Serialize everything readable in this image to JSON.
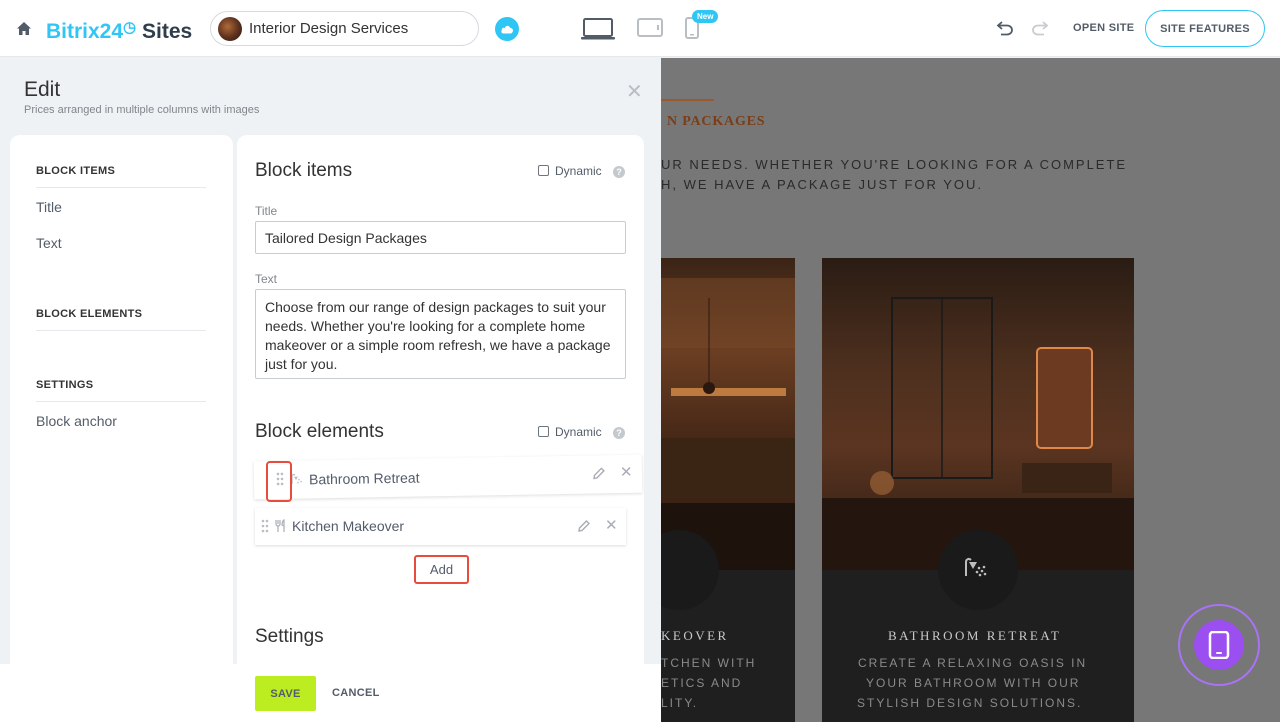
{
  "topbar": {
    "logo_brand": "Bitrix24",
    "logo_sites": "Sites",
    "site_name": "Interior Design Services",
    "new_badge": "New",
    "open_site": "OPEN SITE",
    "site_features": "SITE FEATURES",
    "icons": [
      "home-icon",
      "cloud-icon",
      "desktop-icon",
      "tablet-icon",
      "mobile-icon",
      "undo-icon",
      "redo-icon"
    ]
  },
  "edit": {
    "title": "Edit",
    "subtitle": "Prices arranged in multiple columns with images",
    "nav": {
      "block_items_head": "BLOCK ITEMS",
      "title_item": "Title",
      "text_item": "Text",
      "block_elements_head": "BLOCK ELEMENTS",
      "settings_head": "SETTINGS",
      "block_anchor_item": "Block anchor"
    },
    "form": {
      "block_items_title": "Block items",
      "dynamic_label": "Dynamic",
      "title_label": "Title",
      "title_value": "Tailored Design Packages",
      "text_label": "Text",
      "text_value": "Choose from our range of design packages to suit your needs. Whether you're looking for a complete home makeover or a simple room refresh, we have a package just for you.",
      "block_elements_title": "Block elements",
      "elements": [
        {
          "label": "Bathroom Retreat"
        },
        {
          "label": "Kitchen Makeover"
        }
      ],
      "add_label": "Add",
      "settings_title": "Settings"
    },
    "footer": {
      "save_label": "SAVE",
      "cancel_label": "CANCEL"
    }
  },
  "preview": {
    "heading": "N PACKAGES",
    "text_line1": "UR NEEDS. WHETHER YOU'RE LOOKING FOR A COMPLETE",
    "text_line2": "H, WE HAVE A PACKAGE JUST FOR YOU.",
    "card1_title": "KEOVER",
    "card1_desc1": "TCHEN WITH",
    "card1_desc2": "ETICS AND",
    "card1_desc3": "LITY.",
    "card2_title": "BATHROOM RETREAT",
    "card2_desc1": "CREATE A RELAXING OASIS IN",
    "card2_desc2": "YOUR BATHROOM WITH OUR",
    "card2_desc3": "STYLISH DESIGN SOLUTIONS."
  },
  "colors": {
    "accent": "#2fc6f6",
    "save_green": "#bbed21",
    "highlight_red": "#e74c3c",
    "fab_purple": "#9b4ff0"
  }
}
